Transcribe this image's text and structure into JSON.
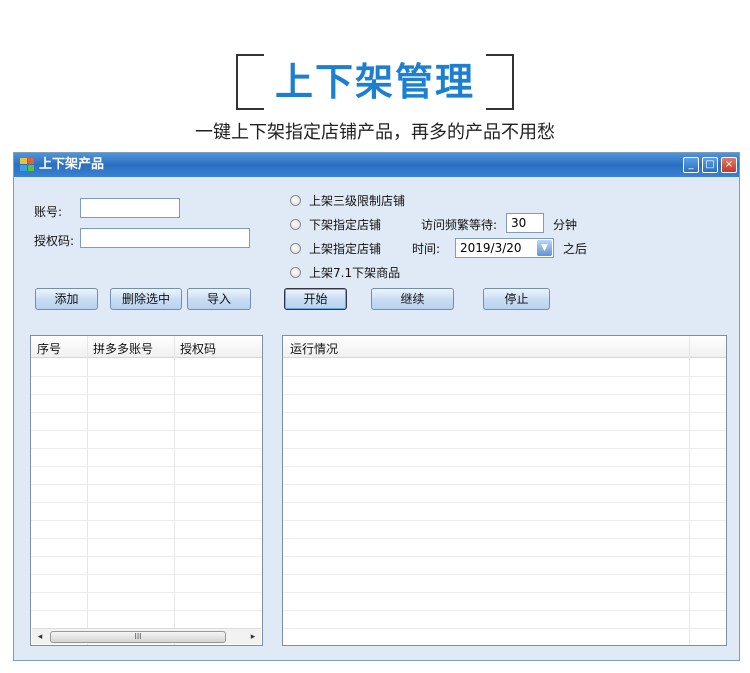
{
  "banner": {
    "title": "上下架管理",
    "subtitle": "一键上下架指定店铺产品，再多的产品不用愁"
  },
  "window": {
    "title": "上下架产品",
    "icons": {
      "app": "app-icon",
      "min": "minimize-icon",
      "max": "maximize-icon",
      "close": "close-icon"
    },
    "min_glyph": "_",
    "max_glyph": "□",
    "close_glyph": "×"
  },
  "form": {
    "account_label": "账号:",
    "account_value": "",
    "auth_label": "授权码:",
    "auth_value": "",
    "radio_options": [
      "上架三级限制店铺",
      "下架指定店铺",
      "上架指定店铺",
      "上架7.1下架商品"
    ],
    "wait_label": "访问频繁等待:",
    "wait_value": "30",
    "wait_unit": "分钟",
    "time_label": "时间:",
    "date_value": "2019/3/20",
    "date_suffix": "之后"
  },
  "buttons": {
    "add": "添加",
    "delete_selected": "删除选中",
    "import": "导入",
    "start": "开始",
    "continue": "继续",
    "stop": "停止"
  },
  "left_table": {
    "columns": [
      "序号",
      "拼多多账号",
      "授权码"
    ],
    "rows": []
  },
  "right_table": {
    "columns": [
      "运行情况"
    ],
    "rows": []
  },
  "scrollbar": {
    "left_arrow": "◂",
    "right_arrow": "▸",
    "grip": "III"
  },
  "colors": {
    "accent": "#1d7fcf",
    "titlebar": "#2a6fc0",
    "client": "#dfeaf6"
  }
}
